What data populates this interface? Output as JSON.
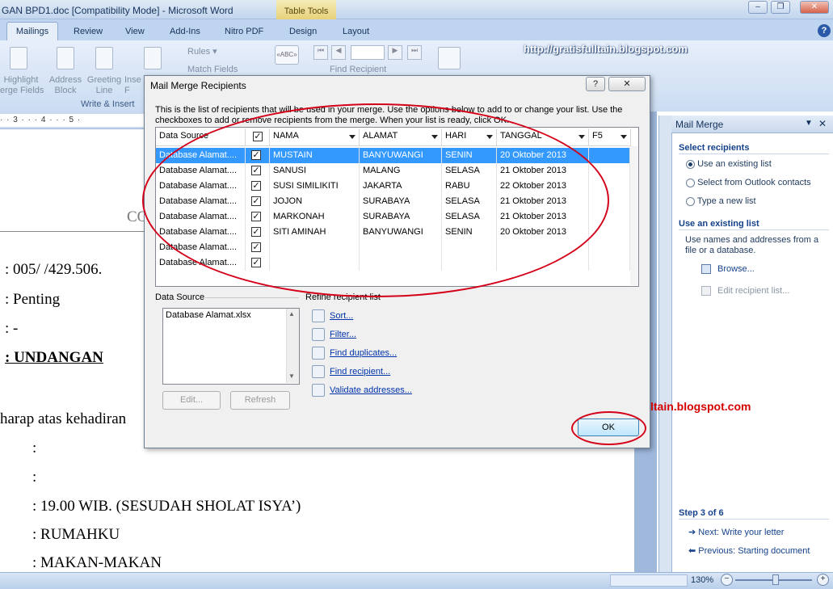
{
  "window": {
    "title": "GAN BPD1.doc [Compatibility Mode] - Microsoft Word",
    "context_tab": "Table Tools",
    "buttons": {
      "minimize": "–",
      "restore": "❐",
      "close": "✕"
    }
  },
  "ribbon_tabs": [
    "Mailings",
    "Review",
    "View",
    "Add-Ins",
    "Nitro PDF",
    "Design",
    "Layout"
  ],
  "ribbon": {
    "buttons": [
      {
        "label1": "Highlight",
        "label2": "erge Fields"
      },
      {
        "label1": "Address",
        "label2": "Block"
      },
      {
        "label1": "Greeting",
        "label2": "Line"
      },
      {
        "label1": "Inse",
        "label2": "F"
      }
    ],
    "rules": "Rules",
    "match_fields": "Match Fields",
    "find_recipient": "Find Recipient",
    "group_label": "Write & Insert"
  },
  "watermark_top": "http://gratisfulltain.blogspot.com",
  "watermark_bottom": "ltain.blogspot.com",
  "ruler": "· · 3 · · · 4 · · · 5 ·",
  "document": {
    "co": "CO",
    "lines": [
      ": 005/        /429.506.",
      ": Penting",
      ": -",
      ": UNDANGAN",
      "harap atas kehadiran",
      ":",
      ":",
      ":  19.00   WIB.  (SESUDAH SHOLAT ISYA’)",
      ":  RUMAHKU",
      ":  MAKAN-MAKAN"
    ]
  },
  "dialog": {
    "title": "Mail Merge Recipients",
    "help": "?",
    "close": "✕",
    "description": "This is the list of recipients that will be used in your merge.  Use the options below to add to or change your list.  Use the checkboxes to add or remove recipients from the merge.  When your list is ready, click OK.",
    "columns": [
      "Data Source",
      "",
      "NAMA",
      "ALAMAT",
      "HARI",
      "TANGGAL",
      "F5"
    ],
    "rows": [
      {
        "source": "Database Alamat....",
        "checked": "✓",
        "nama": "MUSTAIN",
        "alamat": "BANYUWANGI",
        "hari": "SENIN",
        "tanggal": "20 Oktober 2013"
      },
      {
        "source": "Database Alamat....",
        "checked": "✓",
        "nama": "SANUSI",
        "alamat": "MALANG",
        "hari": "SELASA",
        "tanggal": "21 Oktober 2013"
      },
      {
        "source": "Database Alamat....",
        "checked": "✓",
        "nama": "SUSI SIMILIKITI",
        "alamat": "JAKARTA",
        "hari": "RABU",
        "tanggal": "22 Oktober 2013"
      },
      {
        "source": "Database Alamat....",
        "checked": "✓",
        "nama": "JOJON",
        "alamat": "SURABAYA",
        "hari": "SELASA",
        "tanggal": "21 Oktober 2013"
      },
      {
        "source": "Database Alamat....",
        "checked": "✓",
        "nama": "MARKONAH",
        "alamat": "SURABAYA",
        "hari": "SELASA",
        "tanggal": "21 Oktober 2013"
      },
      {
        "source": "Database Alamat....",
        "checked": "✓",
        "nama": "SITI AMINAH",
        "alamat": "BANYUWANGI",
        "hari": "SENIN",
        "tanggal": "20 Oktober 2013"
      },
      {
        "source": "Database Alamat....",
        "checked": "✓",
        "nama": "",
        "alamat": "",
        "hari": "",
        "tanggal": ""
      },
      {
        "source": "Database Alamat....",
        "checked": "✓",
        "nama": "",
        "alamat": "",
        "hari": "",
        "tanggal": ""
      }
    ],
    "data_source_label": "Data Source",
    "data_source_item": "Database Alamat.xlsx",
    "edit_button": "Edit...",
    "refresh_button": "Refresh",
    "refine_label": "Refine recipient list",
    "refine_links": [
      "Sort...",
      "Filter...",
      "Find duplicates...",
      "Find recipient...",
      "Validate addresses..."
    ],
    "ok_button": "OK"
  },
  "taskpane": {
    "title": "Mail Merge",
    "select_heading": "Select recipients",
    "options": [
      "Use an existing list",
      "Select from Outlook contacts",
      "Type a new list"
    ],
    "existing_heading": "Use an existing list",
    "existing_desc1": "Use names and addresses from a",
    "existing_desc2": "file or a database.",
    "browse": "Browse...",
    "edit_list": "Edit recipient list...",
    "step": "Step 3 of 6",
    "next": "Next: Write your letter",
    "previous": "Previous: Starting document"
  },
  "status": {
    "zoom": "130%"
  }
}
